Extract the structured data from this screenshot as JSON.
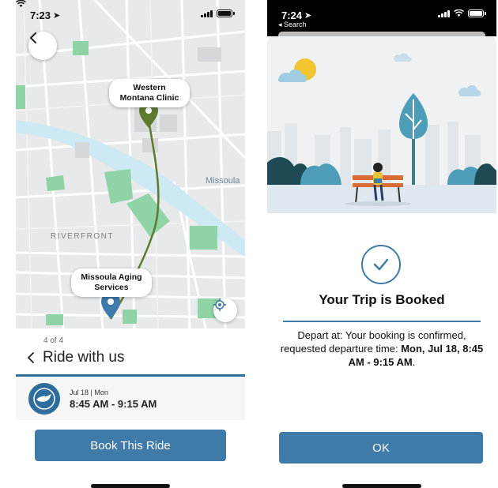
{
  "left_screen": {
    "status_time": "7:23",
    "map": {
      "origin_label": "Western Montana Clinic",
      "destination_label": "Missoula Aging Services",
      "area_labels": [
        "RIVERFRONT",
        "Missoula"
      ]
    },
    "step_indicator": "4 of 4",
    "title": "Ride with us",
    "ride": {
      "date": "Jul 18 | Mon",
      "time": "8:45 AM - 9:15 AM"
    },
    "book_button": "Book This Ride"
  },
  "right_screen": {
    "status_time": "7:24",
    "back_label": "◂ Search",
    "heading": "Your Trip is Booked",
    "message_prefix": "Depart at: Your booking is confirmed, requested departure time: ",
    "message_bold": "Mon, Jul 18, 8:45 AM - 9:15 AM",
    "message_suffix": ".",
    "ok_button": "OK"
  },
  "colors": {
    "primary": "#3f7aa8",
    "route": "#5e7a2f",
    "park": "#8fd3a6",
    "water": "#cde9f4"
  }
}
